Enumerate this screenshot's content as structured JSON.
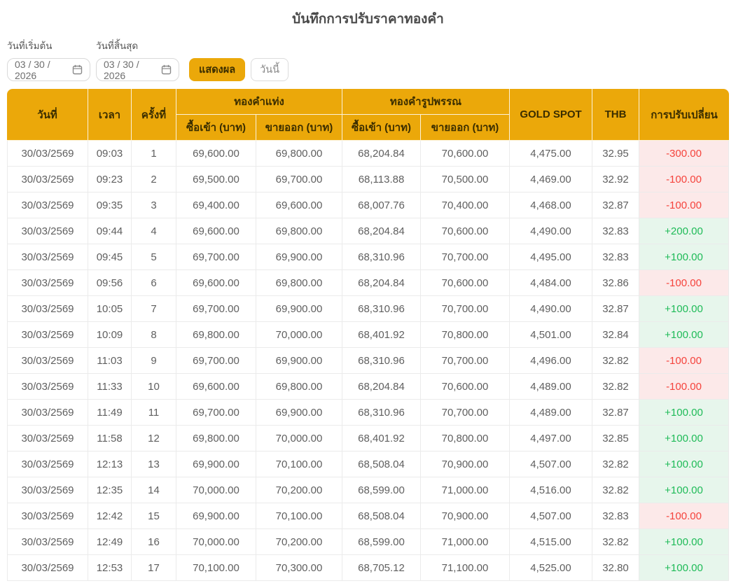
{
  "page": {
    "title": "บันทึกการปรับราคาทองคำ"
  },
  "filters": {
    "start_label": "วันที่เริ่มต้น",
    "end_label": "วันที่สิ้นสุด",
    "start_value": "03 / 30 / 2026",
    "end_value": "03 / 30 / 2026",
    "show_button": "แสดงผล",
    "today_button": "วันนี้"
  },
  "icons": {
    "calendar": "calendar-icon"
  },
  "colors": {
    "header_bg": "#EBA80A",
    "header_text": "#3A2D00",
    "body_text": "#5f5f5f",
    "row_border": "#ebebeb",
    "up_bg": "#E7F6EC",
    "up_text": "#1FBB58",
    "down_bg": "#FCE9E9",
    "down_text": "#F5433C"
  },
  "table": {
    "headers": {
      "date": "วันที่",
      "time": "เวลา",
      "round": "ครั้งที่",
      "gold_bar": "ทองคำแท่ง",
      "gold_ornament": "ทองคำรูปพรรณ",
      "buy": "ซื้อเข้า (บาท)",
      "sell": "ขายออก (บาท)",
      "gold_spot": "GOLD SPOT",
      "thb": "THB",
      "change": "การปรับเปลี่ยน"
    },
    "rows": [
      {
        "date": "30/03/2569",
        "time": "09:03",
        "round": "1",
        "bar_buy": "69,600.00",
        "bar_sell": "69,800.00",
        "orn_buy": "68,204.84",
        "orn_sell": "70,600.00",
        "spot": "4,475.00",
        "thb": "32.95",
        "change": "-300.00",
        "direction": "down"
      },
      {
        "date": "30/03/2569",
        "time": "09:23",
        "round": "2",
        "bar_buy": "69,500.00",
        "bar_sell": "69,700.00",
        "orn_buy": "68,113.88",
        "orn_sell": "70,500.00",
        "spot": "4,469.00",
        "thb": "32.92",
        "change": "-100.00",
        "direction": "down"
      },
      {
        "date": "30/03/2569",
        "time": "09:35",
        "round": "3",
        "bar_buy": "69,400.00",
        "bar_sell": "69,600.00",
        "orn_buy": "68,007.76",
        "orn_sell": "70,400.00",
        "spot": "4,468.00",
        "thb": "32.87",
        "change": "-100.00",
        "direction": "down"
      },
      {
        "date": "30/03/2569",
        "time": "09:44",
        "round": "4",
        "bar_buy": "69,600.00",
        "bar_sell": "69,800.00",
        "orn_buy": "68,204.84",
        "orn_sell": "70,600.00",
        "spot": "4,490.00",
        "thb": "32.83",
        "change": "+200.00",
        "direction": "up"
      },
      {
        "date": "30/03/2569",
        "time": "09:45",
        "round": "5",
        "bar_buy": "69,700.00",
        "bar_sell": "69,900.00",
        "orn_buy": "68,310.96",
        "orn_sell": "70,700.00",
        "spot": "4,495.00",
        "thb": "32.83",
        "change": "+100.00",
        "direction": "up"
      },
      {
        "date": "30/03/2569",
        "time": "09:56",
        "round": "6",
        "bar_buy": "69,600.00",
        "bar_sell": "69,800.00",
        "orn_buy": "68,204.84",
        "orn_sell": "70,600.00",
        "spot": "4,484.00",
        "thb": "32.86",
        "change": "-100.00",
        "direction": "down"
      },
      {
        "date": "30/03/2569",
        "time": "10:05",
        "round": "7",
        "bar_buy": "69,700.00",
        "bar_sell": "69,900.00",
        "orn_buy": "68,310.96",
        "orn_sell": "70,700.00",
        "spot": "4,490.00",
        "thb": "32.87",
        "change": "+100.00",
        "direction": "up"
      },
      {
        "date": "30/03/2569",
        "time": "10:09",
        "round": "8",
        "bar_buy": "69,800.00",
        "bar_sell": "70,000.00",
        "orn_buy": "68,401.92",
        "orn_sell": "70,800.00",
        "spot": "4,501.00",
        "thb": "32.84",
        "change": "+100.00",
        "direction": "up"
      },
      {
        "date": "30/03/2569",
        "time": "11:03",
        "round": "9",
        "bar_buy": "69,700.00",
        "bar_sell": "69,900.00",
        "orn_buy": "68,310.96",
        "orn_sell": "70,700.00",
        "spot": "4,496.00",
        "thb": "32.82",
        "change": "-100.00",
        "direction": "down"
      },
      {
        "date": "30/03/2569",
        "time": "11:33",
        "round": "10",
        "bar_buy": "69,600.00",
        "bar_sell": "69,800.00",
        "orn_buy": "68,204.84",
        "orn_sell": "70,600.00",
        "spot": "4,489.00",
        "thb": "32.82",
        "change": "-100.00",
        "direction": "down"
      },
      {
        "date": "30/03/2569",
        "time": "11:49",
        "round": "11",
        "bar_buy": "69,700.00",
        "bar_sell": "69,900.00",
        "orn_buy": "68,310.96",
        "orn_sell": "70,700.00",
        "spot": "4,489.00",
        "thb": "32.87",
        "change": "+100.00",
        "direction": "up"
      },
      {
        "date": "30/03/2569",
        "time": "11:58",
        "round": "12",
        "bar_buy": "69,800.00",
        "bar_sell": "70,000.00",
        "orn_buy": "68,401.92",
        "orn_sell": "70,800.00",
        "spot": "4,497.00",
        "thb": "32.85",
        "change": "+100.00",
        "direction": "up"
      },
      {
        "date": "30/03/2569",
        "time": "12:13",
        "round": "13",
        "bar_buy": "69,900.00",
        "bar_sell": "70,100.00",
        "orn_buy": "68,508.04",
        "orn_sell": "70,900.00",
        "spot": "4,507.00",
        "thb": "32.82",
        "change": "+100.00",
        "direction": "up"
      },
      {
        "date": "30/03/2569",
        "time": "12:35",
        "round": "14",
        "bar_buy": "70,000.00",
        "bar_sell": "70,200.00",
        "orn_buy": "68,599.00",
        "orn_sell": "71,000.00",
        "spot": "4,516.00",
        "thb": "32.82",
        "change": "+100.00",
        "direction": "up"
      },
      {
        "date": "30/03/2569",
        "time": "12:42",
        "round": "15",
        "bar_buy": "69,900.00",
        "bar_sell": "70,100.00",
        "orn_buy": "68,508.04",
        "orn_sell": "70,900.00",
        "spot": "4,507.00",
        "thb": "32.83",
        "change": "-100.00",
        "direction": "down"
      },
      {
        "date": "30/03/2569",
        "time": "12:49",
        "round": "16",
        "bar_buy": "70,000.00",
        "bar_sell": "70,200.00",
        "orn_buy": "68,599.00",
        "orn_sell": "71,000.00",
        "spot": "4,515.00",
        "thb": "32.82",
        "change": "+100.00",
        "direction": "up"
      },
      {
        "date": "30/03/2569",
        "time": "12:53",
        "round": "17",
        "bar_buy": "70,100.00",
        "bar_sell": "70,300.00",
        "orn_buy": "68,705.12",
        "orn_sell": "71,100.00",
        "spot": "4,525.00",
        "thb": "32.80",
        "change": "+100.00",
        "direction": "up"
      }
    ]
  }
}
